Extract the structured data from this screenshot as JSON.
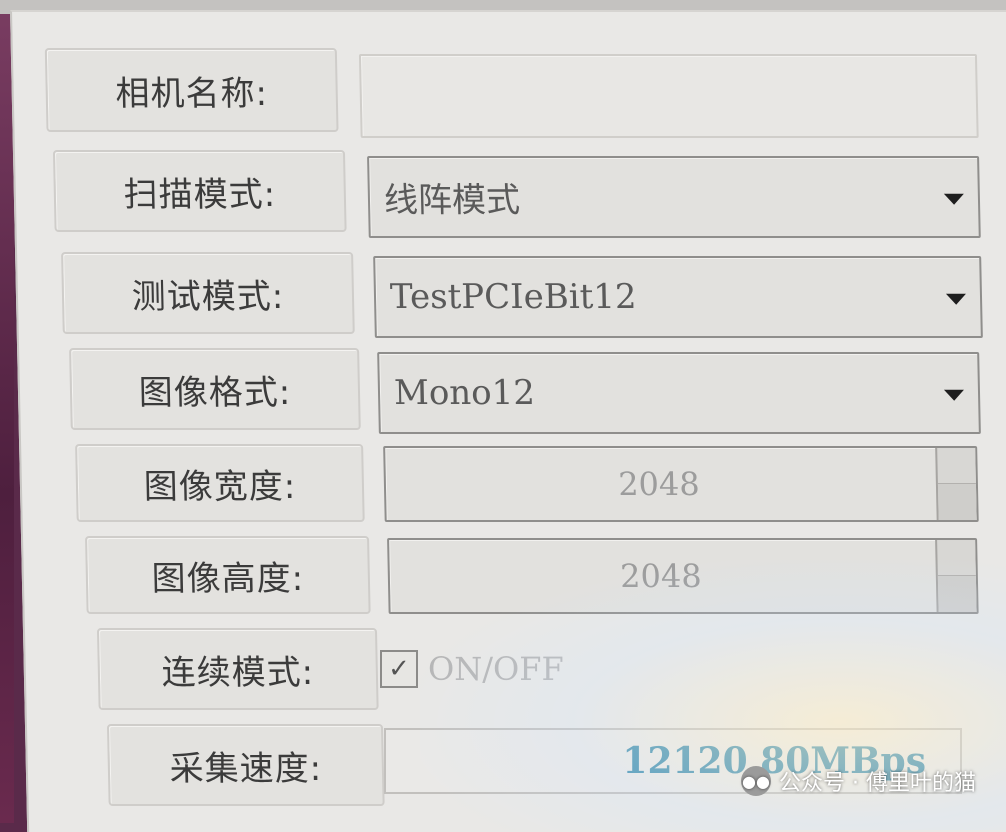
{
  "form": {
    "camera_name": {
      "label": "相机名称:",
      "value": ""
    },
    "scan_mode": {
      "label": "扫描模式:",
      "value": "线阵模式"
    },
    "test_mode": {
      "label": "测试模式:",
      "value": "TestPCIeBit12"
    },
    "image_format": {
      "label": "图像格式:",
      "value": "Mono12"
    },
    "image_width": {
      "label": "图像宽度:",
      "value": "2048"
    },
    "image_height": {
      "label": "图像高度:",
      "value": "2048"
    },
    "continuous_mode": {
      "label": "连续模式:",
      "checkbox_text": "ON/OFF",
      "checked": true,
      "check_glyph": "✓"
    },
    "acquisition_speed": {
      "label": "采集速度:",
      "value": "12120.80MBps"
    }
  },
  "watermark": {
    "text": "公众号 · 傅里叶的猫",
    "icon": "wechat-icon"
  },
  "colors": {
    "speed_text": "#3f8fb0",
    "panel_bg": "#e9e8e6"
  }
}
